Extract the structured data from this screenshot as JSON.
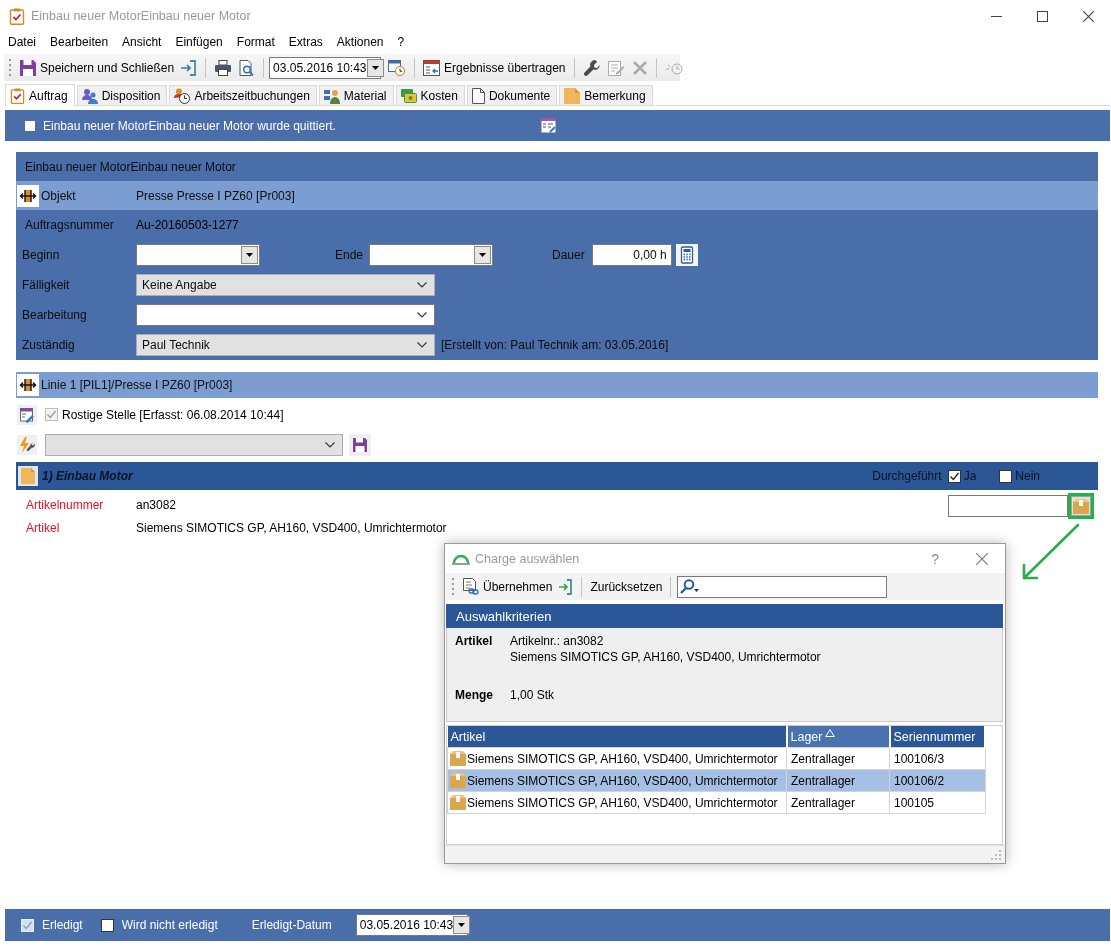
{
  "window": {
    "title": "Einbau neuer MotorEinbau neuer Motor"
  },
  "menu": [
    "Datei",
    "Bearbeiten",
    "Ansicht",
    "Einfügen",
    "Format",
    "Extras",
    "Aktionen",
    "?"
  ],
  "toolbar": {
    "save_close": {
      "label": "Speichern und Schließen"
    },
    "date": {
      "value": "03.05.2016 10:43"
    },
    "transfer": {
      "label": "Ergebnisse übertragen"
    },
    "icon_buttons": [
      {
        "disabled": false
      },
      {
        "disabled": true
      },
      {
        "disabled": true
      },
      {
        "disabled": true
      }
    ]
  },
  "tabs": [
    {
      "label": "Auftrag",
      "selected": true
    },
    {
      "label": "Disposition",
      "selected": false
    },
    {
      "label": "Arbeitszeitbuchungen",
      "selected": false
    },
    {
      "label": "Material",
      "selected": false
    },
    {
      "label": "Kosten",
      "selected": false
    },
    {
      "label": "Dokumente",
      "selected": false
    },
    {
      "label": "Bemerkung",
      "selected": false
    }
  ],
  "banner": {
    "checked": false,
    "text": "Einbau neuer MotorEinbau neuer Motor wurde quittiert."
  },
  "order": {
    "title": "Einbau neuer MotorEinbau neuer Motor",
    "object": {
      "label": "Objekt",
      "value": "Presse Presse I PZ60 [Pr003]"
    },
    "order_number": {
      "label": "Auftragsnummer",
      "value": "Au-20160503-1277"
    },
    "begin": {
      "label": "Beginn"
    },
    "end": {
      "label": "Ende"
    },
    "duration": {
      "label": "Dauer",
      "value": "0,00 h"
    },
    "due": {
      "label": "Fälligkeit",
      "value": "Keine Angabe",
      "editable": false
    },
    "processing": {
      "label": "Bearbeitung",
      "editable": true
    },
    "responsible": {
      "label": "Zuständig",
      "value": "Paul Technik",
      "editable": false,
      "note": "[Erstellt von: Paul Technik am: 03.05.2016]"
    }
  },
  "location": {
    "title": "Linie 1 [PIL1]/Presse I PZ60 [Pr003]",
    "finding": {
      "checked": true,
      "disabled": true,
      "text": "Rostige Stelle [Erfasst: 06.08.2014 10:44]"
    },
    "selector": {
      "editable": false
    }
  },
  "task": {
    "title": "1) Einbau Motor",
    "status_label": "Durchgeführt",
    "options": [
      {
        "label": "Ja",
        "checked": true
      },
      {
        "label": "Nein",
        "checked": false
      }
    ],
    "fields": [
      {
        "label": "Artikelnummer",
        "value": "an3082",
        "required": true
      },
      {
        "label": "Artikel",
        "value": "Siemens SIMOTICS GP, AH160, VSD400, Umrichtermotor",
        "required": true
      }
    ]
  },
  "dialog": {
    "title": "Charge auswählen",
    "help": "?",
    "apply": "Übernehmen",
    "reset": "Zurücksetzen",
    "criteria": {
      "title": "Auswahlkriterien",
      "rows": [
        {
          "label": "Artikel",
          "lines": [
            "Artikelnr.: an3082",
            "Siemens SIMOTICS GP, AH160, VSD400, Umrichtermotor"
          ]
        },
        {
          "label": "Menge",
          "lines": [
            "1,00 Stk"
          ]
        }
      ]
    },
    "table": {
      "columns": [
        {
          "label": "Artikel",
          "sorted": false
        },
        {
          "label": "Lager",
          "sorted": true
        },
        {
          "label": "Seriennummer",
          "sorted": false
        }
      ],
      "rows": [
        {
          "cells": [
            "Siemens SIMOTICS GP, AH160, VSD400, Umrichtermotor",
            "Zentrallager",
            "100106/3"
          ],
          "selected": false
        },
        {
          "cells": [
            "Siemens SIMOTICS GP, AH160, VSD400, Umrichtermotor",
            "Zentrallager",
            "100106/2"
          ],
          "selected": true
        },
        {
          "cells": [
            "Siemens SIMOTICS GP, AH160, VSD400, Umrichtermotor",
            "Zentrallager",
            "100105"
          ],
          "selected": false
        }
      ]
    }
  },
  "footer": {
    "done": {
      "label": "Erledigt",
      "checked": true,
      "disabled": true
    },
    "not_done": {
      "label": "Wird nicht erledigt",
      "checked": false,
      "disabled": false
    },
    "date_label": "Erledigt-Datum",
    "date_value": "03.05.2016 10:43"
  }
}
